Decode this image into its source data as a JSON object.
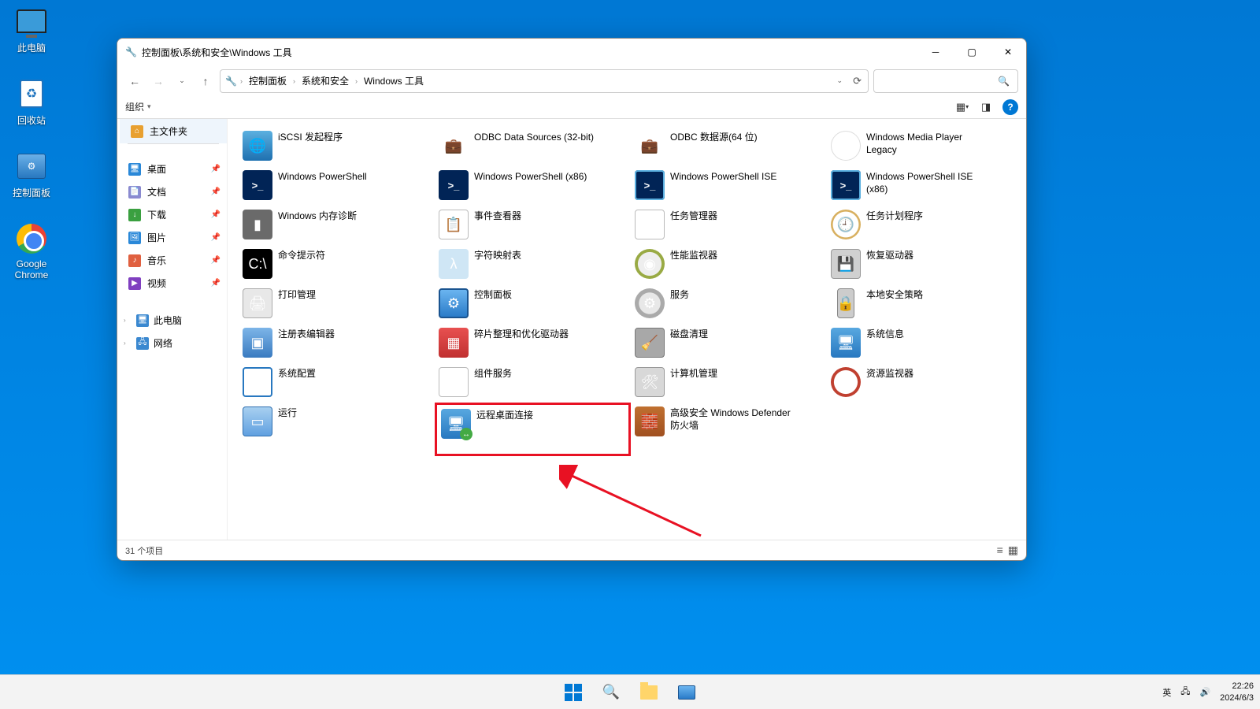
{
  "desktop": {
    "icons": {
      "thispc": "此电脑",
      "recycle": "回收站",
      "cpanel": "控制面板",
      "chrome": "Google Chrome"
    }
  },
  "window": {
    "title": "控制面板\\系统和安全\\Windows 工具",
    "breadcrumb": [
      "控制面板",
      "系统和安全",
      "Windows 工具"
    ],
    "toolbar": {
      "organize": "组织"
    },
    "sidebar": {
      "home": "主文件夹",
      "quick": [
        {
          "label": "桌面",
          "color": "#2a88d8"
        },
        {
          "label": "文档",
          "color": "#8a8ad0"
        },
        {
          "label": "下载",
          "color": "#3aa040"
        },
        {
          "label": "图片",
          "color": "#2a88d8"
        },
        {
          "label": "音乐",
          "color": "#e06040"
        },
        {
          "label": "视频",
          "color": "#8040c0"
        }
      ],
      "thispc": "此电脑",
      "network": "网络"
    },
    "items": [
      [
        {
          "l": "iSCSI 发起程序",
          "c": "globe"
        },
        {
          "l": "ODBC Data Sources (32-bit)",
          "c": "case"
        },
        {
          "l": "ODBC 数据源(64 位)",
          "c": "case"
        },
        {
          "l": "Windows Media Player Legacy",
          "c": "play"
        }
      ],
      [
        {
          "l": "Windows PowerShell",
          "c": "ps"
        },
        {
          "l": "Windows PowerShell (x86)",
          "c": "ps"
        },
        {
          "l": "Windows PowerShell ISE",
          "c": "ps2"
        },
        {
          "l": "Windows PowerShell ISE (x86)",
          "c": "ps2"
        }
      ],
      [
        {
          "l": "Windows 内存诊断",
          "c": "mem"
        },
        {
          "l": "事件查看器",
          "c": "ev"
        },
        {
          "l": "任务管理器",
          "c": "task"
        },
        {
          "l": "任务计划程序",
          "c": "clock"
        }
      ],
      [
        {
          "l": "命令提示符",
          "c": "cmd"
        },
        {
          "l": "字符映射表",
          "c": "char"
        },
        {
          "l": "性能监视器",
          "c": "perf"
        },
        {
          "l": "恢复驱动器",
          "c": "drive"
        }
      ],
      [
        {
          "l": "打印管理",
          "c": "printer"
        },
        {
          "l": "控制面板",
          "c": "cp"
        },
        {
          "l": "服务",
          "c": "svc"
        },
        {
          "l": "本地安全策略",
          "c": "tower"
        }
      ],
      [
        {
          "l": "注册表编辑器",
          "c": "reg"
        },
        {
          "l": "碎片整理和优化驱动器",
          "c": "defrag"
        },
        {
          "l": "磁盘清理",
          "c": "cleanup"
        },
        {
          "l": "系统信息",
          "c": "sysinfo"
        }
      ],
      [
        {
          "l": "系统配置",
          "c": "config"
        },
        {
          "l": "组件服务",
          "c": "comp"
        },
        {
          "l": "计算机管理",
          "c": "mgmt"
        },
        {
          "l": "资源监视器",
          "c": "res"
        }
      ],
      [
        {
          "l": "运行",
          "c": "run"
        },
        {
          "l": "远程桌面连接",
          "c": "rdc",
          "hi": true
        },
        {
          "l": "高级安全 Windows Defender 防火墙",
          "c": "wall"
        },
        {
          "l": "",
          "c": ""
        }
      ]
    ],
    "status": "31 个项目"
  },
  "taskbar": {
    "ime": "英",
    "time": "22:26",
    "date": "2024/6/3"
  }
}
